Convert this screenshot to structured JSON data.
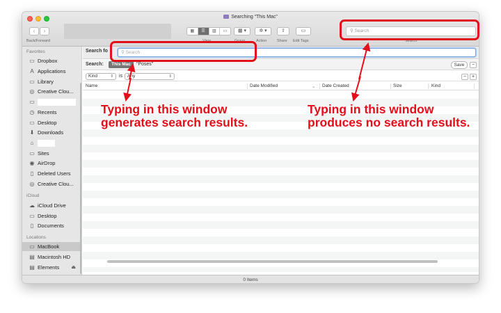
{
  "window": {
    "title": "Searching “This Mac”",
    "status": "0 Items"
  },
  "toolbar": {
    "back_forward_label": "Back/Forward",
    "view_label": "View",
    "group_label": "Group",
    "action_label": "Action",
    "share_label": "Share",
    "edit_tags_label": "Edit Tags",
    "search_label": "Search",
    "search_placeholder": "Search",
    "back_glyph": "‹",
    "forward_glyph": "›"
  },
  "sidebar": {
    "favorites_heading": "Favorites",
    "favorites": [
      {
        "label": "Dropbox",
        "icon": "folder-icon"
      },
      {
        "label": "Applications",
        "icon": "applications-icon"
      },
      {
        "label": "Library",
        "icon": "folder-icon"
      },
      {
        "label": "Creative Clou...",
        "icon": "creative-cloud-icon"
      },
      {
        "label": "",
        "icon": "folder-icon"
      },
      {
        "label": "Recents",
        "icon": "recents-icon"
      },
      {
        "label": "Desktop",
        "icon": "desktop-icon"
      },
      {
        "label": "Downloads",
        "icon": "downloads-icon"
      },
      {
        "label": "",
        "icon": "home-icon"
      },
      {
        "label": "Sites",
        "icon": "folder-icon"
      },
      {
        "label": "AirDrop",
        "icon": "airdrop-icon"
      },
      {
        "label": "Deleted Users",
        "icon": "document-icon"
      },
      {
        "label": "Creative Clou...",
        "icon": "creative-cloud-icon"
      }
    ],
    "icloud_heading": "iCloud",
    "icloud": [
      {
        "label": "iCloud Drive",
        "icon": "cloud-icon"
      },
      {
        "label": "Desktop",
        "icon": "desktop-icon"
      },
      {
        "label": "Documents",
        "icon": "documents-icon"
      }
    ],
    "locations_heading": "Locations",
    "locations": [
      {
        "label": "MacBook",
        "icon": "laptop-icon"
      },
      {
        "label": "Macintosh HD",
        "icon": "disk-icon"
      },
      {
        "label": "Elements",
        "icon": "disk-icon"
      }
    ]
  },
  "search_bar": {
    "label": "Search fo",
    "placeholder": "Search",
    "scope_label": "Search:",
    "scope_this_mac": "This Mac",
    "scope_other": "“Poses”",
    "save_label": "Save"
  },
  "criteria": {
    "attribute": "Kind",
    "operator": "is",
    "value": "Any"
  },
  "columns": [
    "Name",
    "Date Modified",
    "Date Created",
    "Size",
    "Kind"
  ],
  "annotations": {
    "left_line1": "Typing in this window",
    "left_line2": "generates search results.",
    "right_line1": "Typing in this window",
    "right_line2": "produces no search results.",
    "color": "#e30f1a"
  }
}
